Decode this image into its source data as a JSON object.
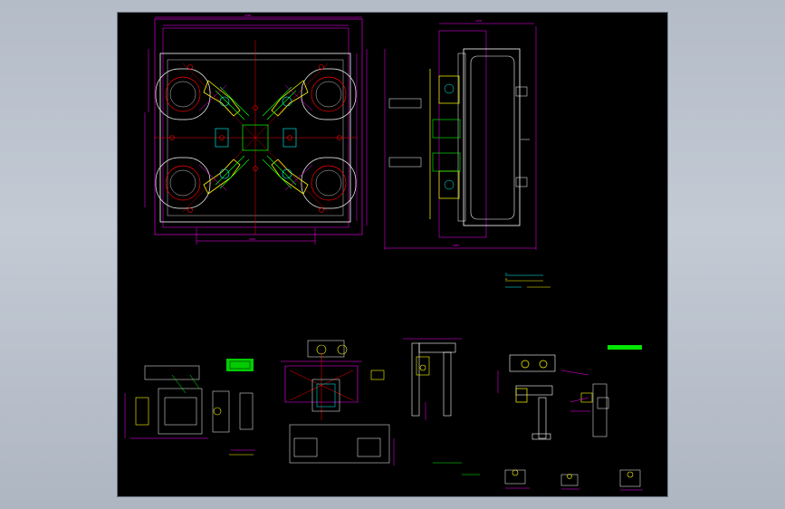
{
  "viewer": {
    "background_color": "#b9c1cc",
    "sheet_color": "#000000",
    "title": ""
  },
  "drawing": {
    "line_colors": {
      "geometry": "#ffffff",
      "dimension": "#ff00ff",
      "center": "#ff0000",
      "part_yellow": "#ffff00",
      "part_green": "#00ff00",
      "part_cyan": "#00ffff"
    },
    "notes": {
      "main_plan_dim_top": "1430",
      "main_plan_dim_bottom": "1015",
      "side_view_dim_top": "1270",
      "side_view_dim_bottom": "1007",
      "tech_req_line1": "1.  ",
      "tech_req_line2": "2.  ",
      "tech_req_label": "",
      "detail_title": ""
    }
  }
}
